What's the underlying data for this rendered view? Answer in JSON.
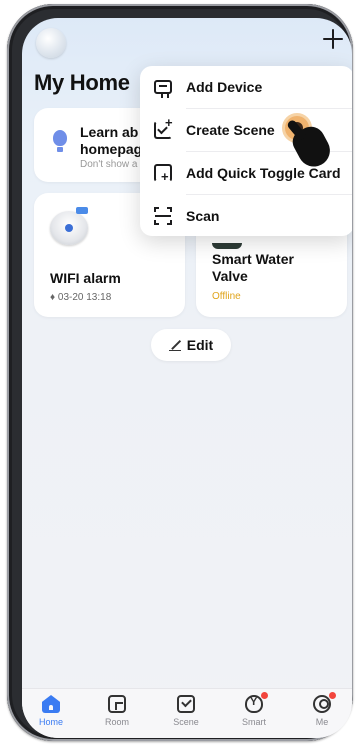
{
  "header": {
    "title": "My Home"
  },
  "learn_card": {
    "title_line1": "Learn ab",
    "title_line2": "homepag",
    "subtitle": "Don't show a"
  },
  "devices": [
    {
      "name": "WIFI alarm",
      "status": "03-20 13:18",
      "status_icon": "bell-icon"
    },
    {
      "name_line1": "Smart Water",
      "name_line2": "Valve",
      "status": "Offline",
      "status_color": "#e0a41b"
    }
  ],
  "edit": {
    "label": "Edit"
  },
  "menu": {
    "items": [
      {
        "label": "Add Device",
        "icon": "add-device-icon"
      },
      {
        "label": "Create Scene",
        "icon": "create-scene-icon"
      },
      {
        "label": "Add Quick Toggle Card",
        "icon": "quick-toggle-icon"
      },
      {
        "label": "Scan",
        "icon": "scan-icon"
      }
    ]
  },
  "bottom_nav": {
    "items": [
      {
        "label": "Home",
        "active": true
      },
      {
        "label": "Room"
      },
      {
        "label": "Scene"
      },
      {
        "label": "Smart",
        "badge": true
      },
      {
        "label": "Me",
        "badge": true
      }
    ]
  },
  "colors": {
    "accent": "#3a7bf2",
    "badge": "#f2453d",
    "offline": "#e0a41b"
  }
}
